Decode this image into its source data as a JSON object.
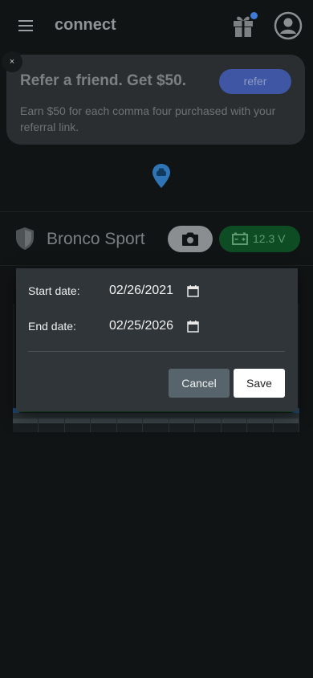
{
  "header": {
    "title": "connect",
    "menu_icon": "hamburger-menu-icon",
    "gift_icon": "gift-icon",
    "account_icon": "account-circle-icon",
    "notification_color": "#3e7bd6"
  },
  "referral": {
    "close_label": "×",
    "title": "Refer a friend. Get $50.",
    "button_label": "refer",
    "body": "Earn $50 for each comma four purchased with your referral link."
  },
  "map": {
    "pin_icon": "car-location-pin-icon"
  },
  "vehicle": {
    "name": "Bronco Sport",
    "shield_icon": "shield-icon",
    "camera_icon": "camera-icon",
    "battery_icon": "car-battery-icon",
    "battery_voltage": "12.3 V",
    "battery_color": "#0e4c24"
  },
  "date_dialog": {
    "start_label": "Start date:",
    "start_value": "02/26/2021",
    "end_label": "End date:",
    "end_value": "02/25/2026",
    "calendar_icon": "calendar-icon",
    "cancel_label": "Cancel",
    "save_label": "Save"
  }
}
